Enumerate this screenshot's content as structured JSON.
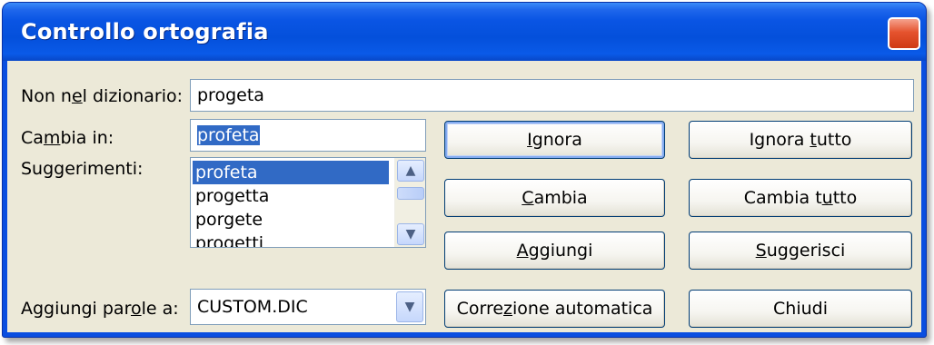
{
  "window": {
    "title": "Controllo ortografia",
    "close_glyph": "✕"
  },
  "labels": {
    "not_in_dictionary": [
      "Non n",
      "e",
      "l dizionario:"
    ],
    "change_to": [
      "Ca",
      "m",
      "bia in:"
    ],
    "suggestions": "Suggerimenti:",
    "add_words_to": [
      "Aggiungi par",
      "o",
      "le a:"
    ]
  },
  "fields": {
    "not_in_dictionary_value": "progeta",
    "change_to_value": "profeta",
    "add_words_to_value": "CUSTOM.DIC"
  },
  "suggestions": [
    "profeta",
    "progetta",
    "porgete",
    "progetti"
  ],
  "selected_suggestion_index": 0,
  "buttons": {
    "ignore": [
      "",
      "I",
      "gnora"
    ],
    "ignore_all": [
      "Ignora ",
      "t",
      "utto"
    ],
    "change": [
      "",
      "C",
      "ambia"
    ],
    "change_all": [
      "Cambia t",
      "u",
      "tto"
    ],
    "add": [
      "",
      "A",
      "ggiungi"
    ],
    "suggest": [
      "",
      "S",
      "uggerisci"
    ],
    "autocorrect": [
      "Corre",
      "z",
      "ione automatica"
    ],
    "close": "Chiudi"
  },
  "icons": {
    "scroll_up": "▲",
    "scroll_down": "▼",
    "combo_dropdown": "▼"
  },
  "colors": {
    "titlebar": "#0a55e4",
    "client": "#ece9d8",
    "selection": "#316ac5",
    "close_button": "#e5532e"
  }
}
